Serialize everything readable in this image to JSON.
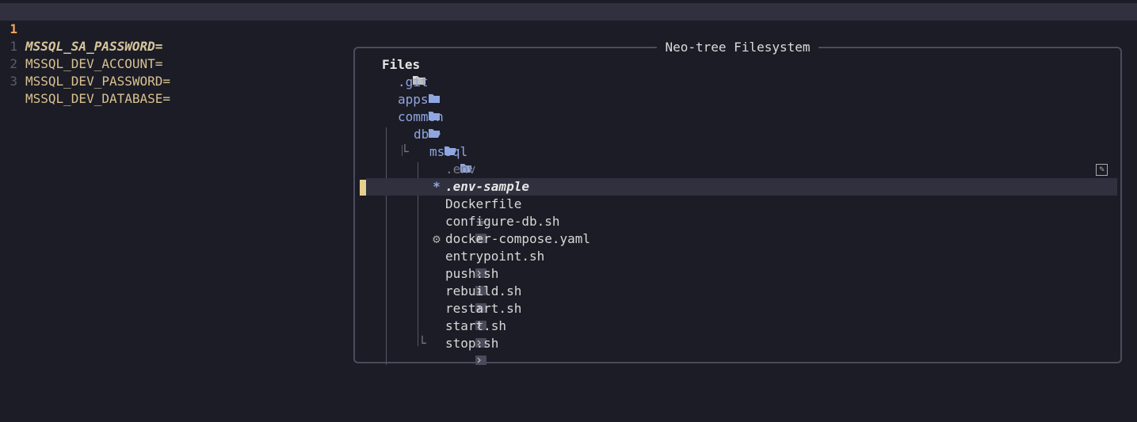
{
  "editor": {
    "lines": [
      {
        "num": "1",
        "text": "MSSQL_SA_PASSWORD="
      },
      {
        "num": "1",
        "text": "MSSQL_DEV_ACCOUNT="
      },
      {
        "num": "2",
        "text": "MSSQL_DEV_PASSWORD="
      },
      {
        "num": "3",
        "text": "MSSQL_DEV_DATABASE="
      }
    ]
  },
  "neotree": {
    "title": "Neo-tree Filesystem",
    "root": "Files",
    "items": [
      {
        "label": ".git",
        "icon": "folder-icon"
      },
      {
        "label": "apps",
        "icon": "folder-icon"
      },
      {
        "label": "common",
        "icon": "folder-open-icon"
      },
      {
        "label": "db",
        "icon": "folder-open-icon"
      },
      {
        "label": "mssql",
        "icon": "folder-open-icon"
      },
      {
        "label": ".env",
        "icon": "settings-sliders-icon"
      },
      {
        "label": ".env-sample",
        "icon": "asterisk-icon"
      },
      {
        "label": "Dockerfile",
        "icon": "docker-icon"
      },
      {
        "label": "configure-db.sh",
        "icon": "terminal-icon"
      },
      {
        "label": "docker-compose.yaml",
        "icon": "gear-icon"
      },
      {
        "label": "entrypoint.sh",
        "icon": "terminal-icon"
      },
      {
        "label": "push.sh",
        "icon": "terminal-icon"
      },
      {
        "label": "rebuild.sh",
        "icon": "terminal-icon"
      },
      {
        "label": "restart.sh",
        "icon": "terminal-icon"
      },
      {
        "label": "start.sh",
        "icon": "terminal-icon"
      },
      {
        "label": "stop.sh",
        "icon": "terminal-icon"
      }
    ]
  },
  "colors": {
    "background": "#1c1c26",
    "cursorline": "#30303f",
    "directory": "#8fa6e0",
    "env_text": "#d9c28f",
    "line_number_active": "#f6a45a"
  }
}
